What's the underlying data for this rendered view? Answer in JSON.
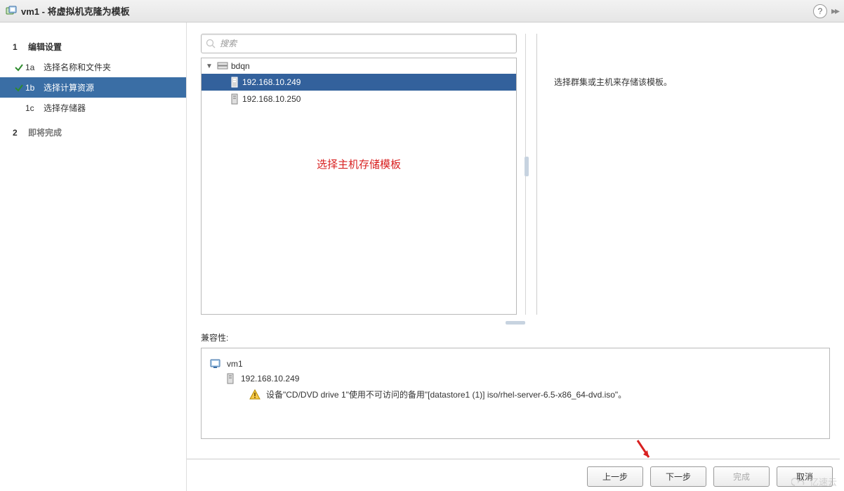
{
  "title": "vm1 - 将虚拟机克隆为模板",
  "help_label": "?",
  "sidebar": {
    "step1": {
      "num": "1",
      "label": "编辑设置"
    },
    "step1a": {
      "num": "1a",
      "label": "选择名称和文件夹",
      "done": true
    },
    "step1b": {
      "num": "1b",
      "label": "选择计算资源",
      "active": true,
      "done": true
    },
    "step1c": {
      "num": "1c",
      "label": "选择存储器"
    },
    "step2": {
      "num": "2",
      "label": "即将完成"
    }
  },
  "search": {
    "placeholder": "搜索"
  },
  "tree": {
    "root": "bdqn",
    "hosts": [
      "192.168.10.249",
      "192.168.10.250"
    ],
    "selected_index": 0,
    "note": "选择主机存储模板"
  },
  "right_desc": "选择群集或主机来存储该模板。",
  "compat_label": "兼容性:",
  "compat": {
    "vm": "vm1",
    "host": "192.168.10.249",
    "warning": "设备\"CD/DVD drive 1\"使用不可访问的备用\"[datastore1 (1)] iso/rhel-server-6.5-x86_64-dvd.iso\"。"
  },
  "buttons": {
    "back": "上一步",
    "next": "下一步",
    "finish": "完成",
    "cancel": "取消"
  },
  "watermark": "亿速云"
}
